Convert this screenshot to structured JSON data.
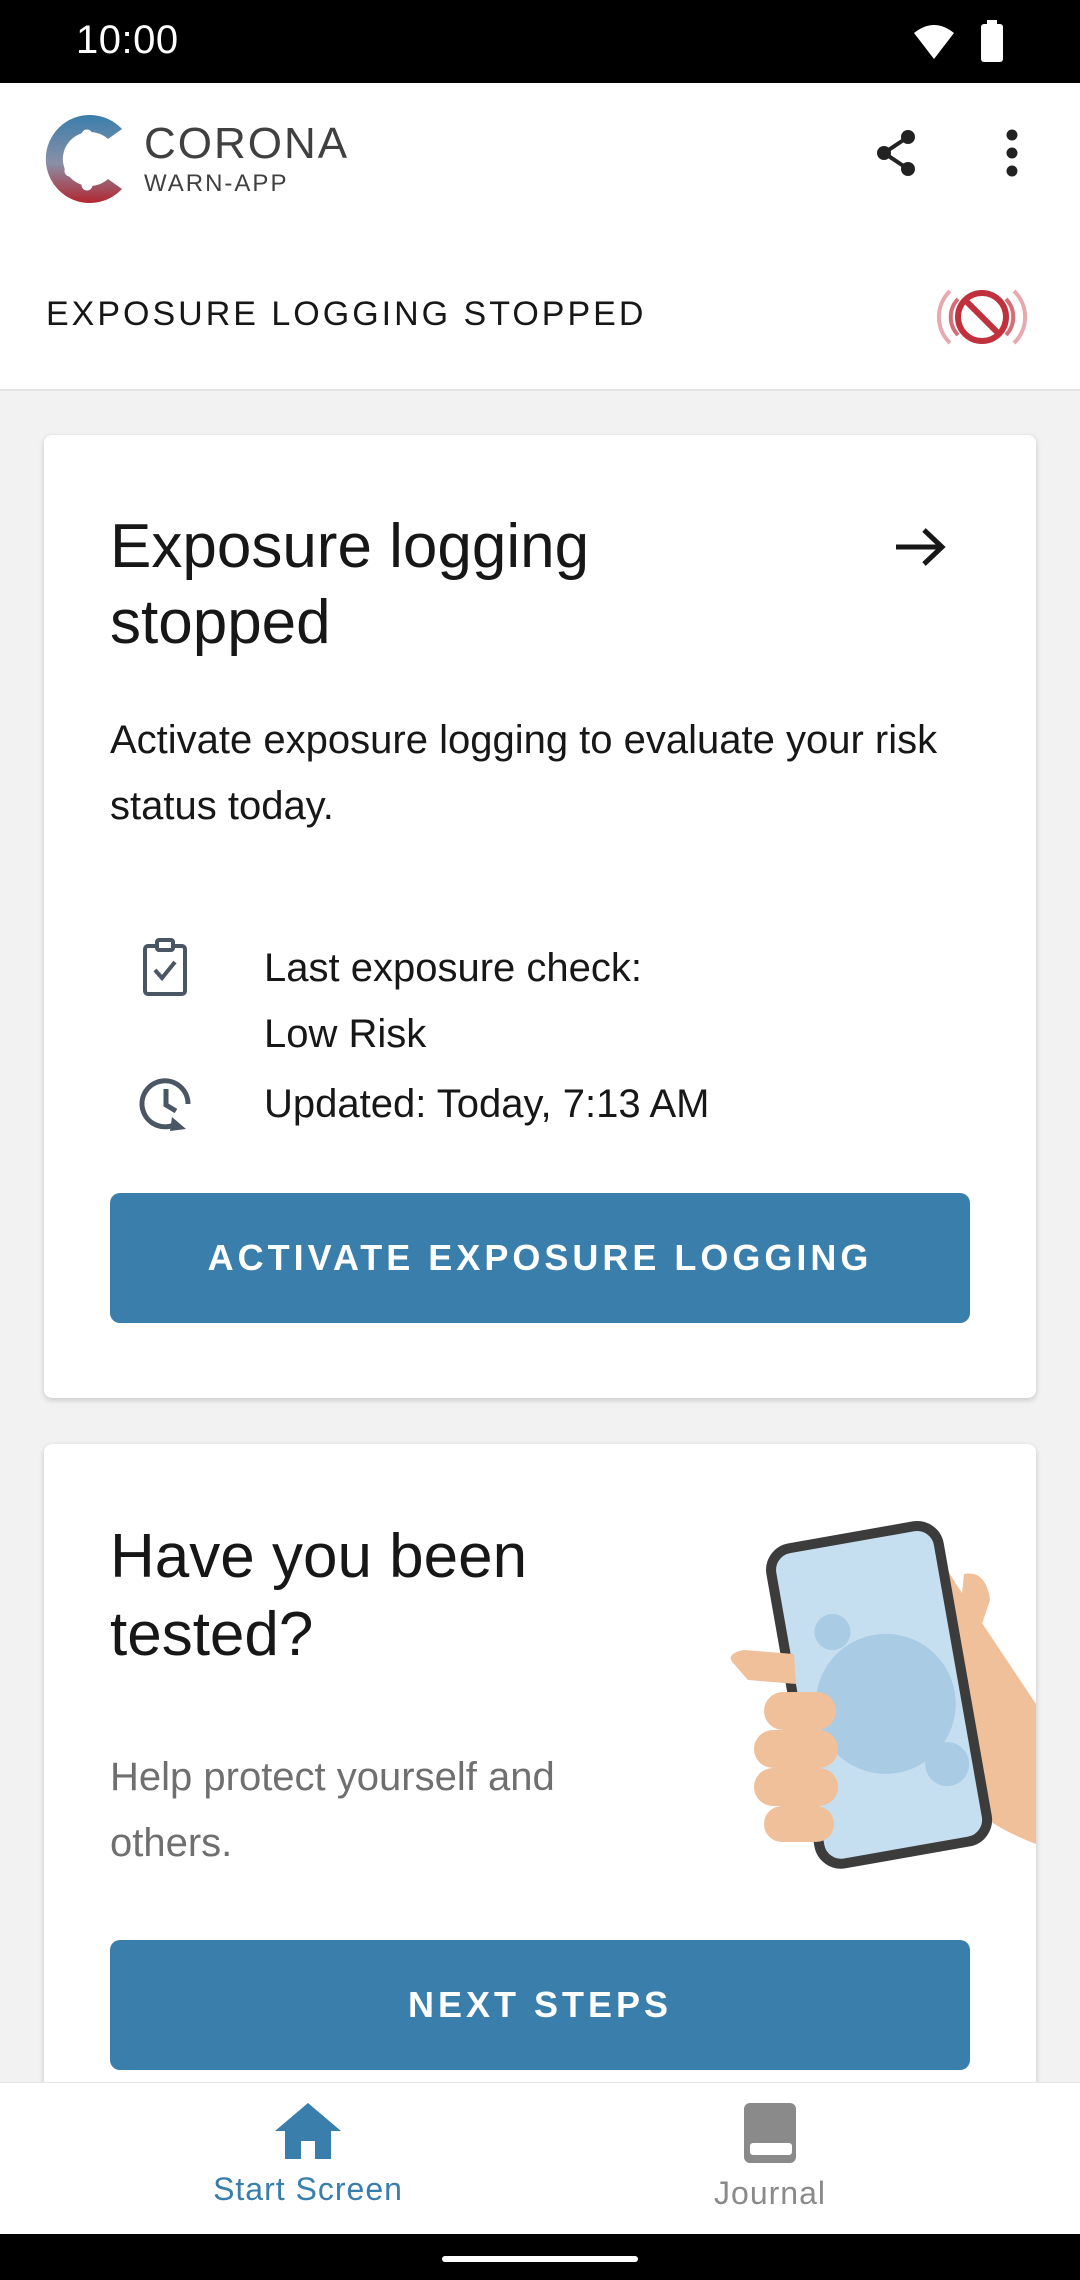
{
  "status_bar": {
    "time": "10:00"
  },
  "app_bar": {
    "logo_title": "CORONA",
    "logo_subtitle": "WARN-APP"
  },
  "sub_header": {
    "title": "EXPOSURE LOGGING STOPPED"
  },
  "risk_card": {
    "title": "Exposure logging stopped",
    "description": "Activate exposure logging to evaluate your risk status today.",
    "last_check_label": "Last exposure check:",
    "last_check_value": "Low Risk",
    "updated": "Updated: Today, 7:13 AM",
    "button_label": "ACTIVATE EXPOSURE LOGGING"
  },
  "test_card": {
    "title": "Have you been tested?",
    "description": "Help protect yourself and others.",
    "button_label": "NEXT STEPS"
  },
  "bottom_nav": {
    "items": [
      {
        "label": "Start Screen",
        "icon": "home-icon",
        "active": true
      },
      {
        "label": "Journal",
        "icon": "book-icon",
        "active": false
      }
    ]
  },
  "colors": {
    "accent": "#3a7eac",
    "alert_red": "#c0313d",
    "logo_red": "#b3262f",
    "logo_blue": "#3a7eac"
  }
}
